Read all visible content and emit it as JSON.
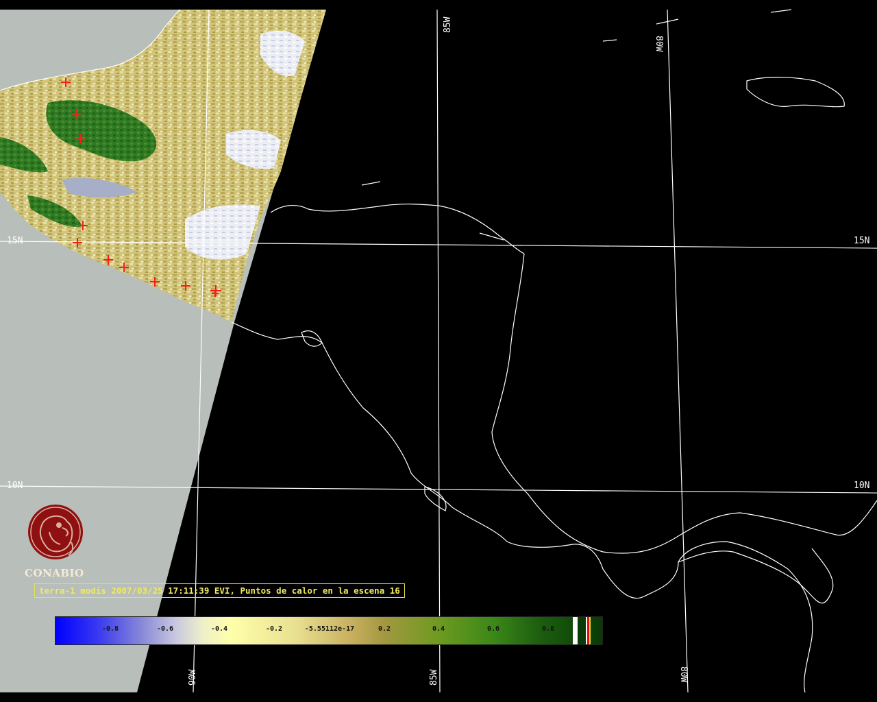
{
  "map": {
    "grid": {
      "lat_labels": [
        "15N",
        "10N"
      ],
      "lon_labels": [
        "85W",
        "80W",
        "90W"
      ]
    },
    "scene": {
      "satellite": "terra-1",
      "sensor": "modis",
      "product": "EVI",
      "overlay": "Puntos de calor",
      "fire_markers_count": 11
    },
    "colors": {
      "background": "#000000",
      "land_outline": "#ffffff",
      "no_data": "#b8beb9",
      "fire_marker": "#ff1a1a",
      "caption": "#f0ea60"
    }
  },
  "logo": {
    "name": "CONABIO"
  },
  "caption": {
    "text": "terra-1 modis 2007/03/25 17:11:39 EVI, Puntos de calor en la escena 16"
  },
  "colorbar": {
    "ticks": [
      "-0.8",
      "-0.6",
      "-0.4",
      "-0.2",
      "-5.55112e-17",
      "0.2",
      "0.4",
      "0.6",
      "0.8"
    ],
    "range": [
      -1,
      1
    ]
  }
}
